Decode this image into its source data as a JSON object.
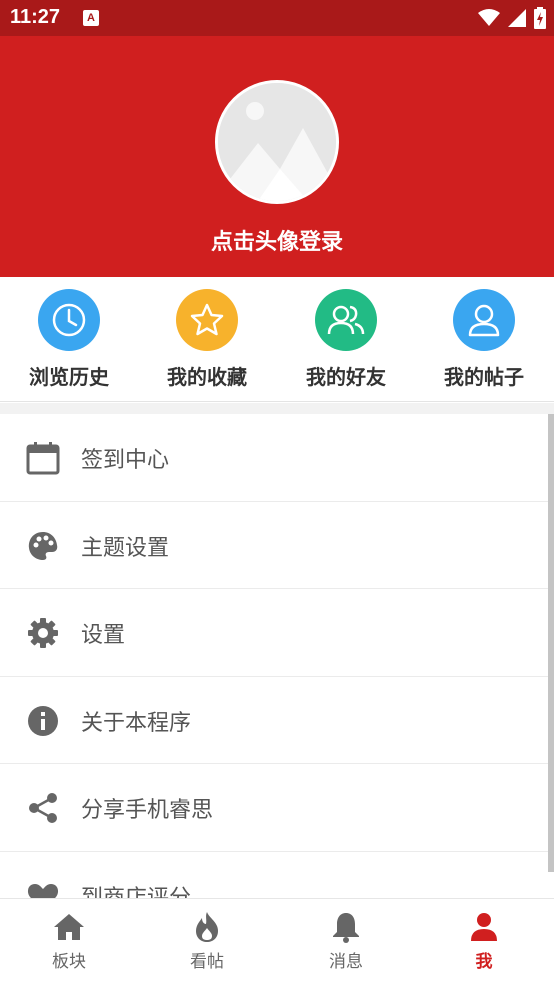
{
  "status": {
    "time": "11:27",
    "app_icon": "A"
  },
  "profile": {
    "login_text": "点击头像登录"
  },
  "quick_actions": [
    {
      "label": "浏览历史",
      "icon": "clock-icon",
      "color": "#3aa6f0"
    },
    {
      "label": "我的收藏",
      "icon": "star-icon",
      "color": "#f7b22c"
    },
    {
      "label": "我的好友",
      "icon": "friends-icon",
      "color": "#22bb85"
    },
    {
      "label": "我的帖子",
      "icon": "person-icon",
      "color": "#3aa6f0"
    }
  ],
  "menu": [
    {
      "label": "签到中心",
      "icon": "calendar-icon"
    },
    {
      "label": "主题设置",
      "icon": "palette-icon"
    },
    {
      "label": "设置",
      "icon": "gear-icon"
    },
    {
      "label": "关于本程序",
      "icon": "info-icon"
    },
    {
      "label": "分享手机睿思",
      "icon": "share-icon"
    },
    {
      "label": "到商店评分",
      "icon": "heart-icon"
    }
  ],
  "bottom_nav": [
    {
      "label": "板块",
      "icon": "home-icon"
    },
    {
      "label": "看帖",
      "icon": "flame-icon"
    },
    {
      "label": "消息",
      "icon": "bell-icon"
    },
    {
      "label": "我",
      "icon": "me-icon",
      "active": true
    }
  ],
  "colors": {
    "header": "#d01f1f",
    "status_bar": "#a91919",
    "accent": "#d01f1f",
    "icon_gray": "#666666"
  }
}
